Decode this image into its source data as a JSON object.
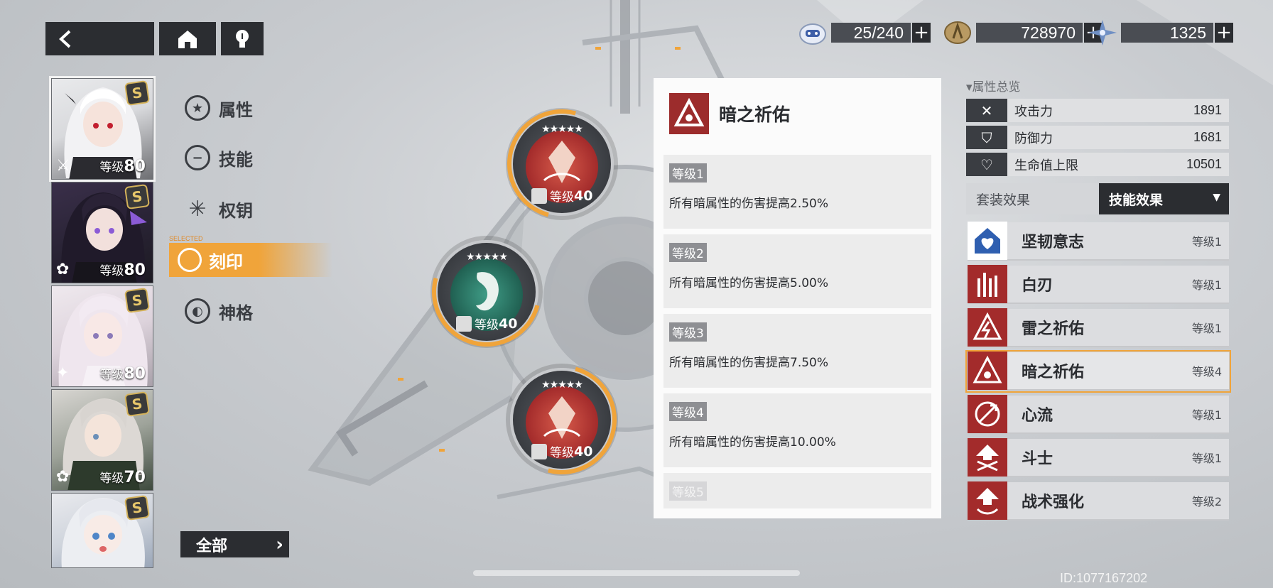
{
  "currencies": [
    {
      "name": "stamina",
      "icon": "stamina-icon",
      "value": "25/240"
    },
    {
      "name": "coin",
      "icon": "coin-icon",
      "value": "728970"
    },
    {
      "name": "crystal",
      "icon": "crystal-icon",
      "value": "1325"
    }
  ],
  "characters": [
    {
      "level_prefix": "等级",
      "level": "80",
      "badge": "S",
      "hair": "#eaeaec",
      "accent": "#c21f2f"
    },
    {
      "level_prefix": "等级",
      "level": "80",
      "badge": "S",
      "hair": "#2a2436",
      "accent": "#8b5bd6"
    },
    {
      "level_prefix": "等级",
      "level": "80",
      "badge": "S",
      "hair": "#e8dfe6",
      "accent": "#b7a6c9"
    },
    {
      "level_prefix": "等级",
      "level": "70",
      "badge": "S",
      "hair": "#d9d6d2",
      "accent": "#3a4a3a"
    },
    {
      "level_prefix": "",
      "level": "",
      "badge": "S",
      "hair": "#e6e8ee",
      "accent": "#7fa6d6"
    }
  ],
  "menu": {
    "attr": "属性",
    "skill": "技能",
    "key": "权钥",
    "selected_tag": "SELECTED",
    "imprint": "刻印",
    "divinity": "神格"
  },
  "all_button": "全部",
  "nodes": [
    {
      "stars": "★★★★★",
      "level_prefix": "等级",
      "level": "40"
    },
    {
      "stars": "★★★★★",
      "level_prefix": "等级",
      "level": "40"
    },
    {
      "stars": "★★★★★",
      "level_prefix": "等级",
      "level": "40"
    }
  ],
  "detail": {
    "title": "暗之祈佑",
    "levels": [
      {
        "tag": "等级1",
        "desc": "所有暗属性的伤害提高2.50%"
      },
      {
        "tag": "等级2",
        "desc": "所有暗属性的伤害提高5.00%"
      },
      {
        "tag": "等级3",
        "desc": "所有暗属性的伤害提高7.50%"
      },
      {
        "tag": "等级4",
        "desc": "所有暗属性的伤害提高10.00%"
      },
      {
        "tag": "等级5",
        "desc": ""
      }
    ]
  },
  "overview": {
    "title": "▾属性总览",
    "stats": [
      {
        "label": "攻击力",
        "value": "1891",
        "icon": "attack-icon"
      },
      {
        "label": "防御力",
        "value": "1681",
        "icon": "defense-icon"
      },
      {
        "label": "生命值上限",
        "value": "10501",
        "icon": "heart-icon"
      }
    ]
  },
  "tabs": {
    "set_effect": "套装效果",
    "skill_effect": "技能效果",
    "dropdown": "▼"
  },
  "effects": [
    {
      "label": "坚韧意志",
      "level": "等级1",
      "icon": "tenacity-icon",
      "color": "#2f5fb0"
    },
    {
      "label": "白刃",
      "level": "等级1",
      "icon": "blade-icon",
      "color": "#a32b2b"
    },
    {
      "label": "雷之祈佑",
      "level": "等级1",
      "icon": "thunder-icon",
      "color": "#a32b2b"
    },
    {
      "label": "暗之祈佑",
      "level": "等级4",
      "icon": "dark-icon",
      "color": "#a32b2b"
    },
    {
      "label": "心流",
      "level": "等级1",
      "icon": "flow-icon",
      "color": "#a32b2b"
    },
    {
      "label": "斗士",
      "level": "等级1",
      "icon": "fighter-icon",
      "color": "#a32b2b"
    },
    {
      "label": "战术强化",
      "level": "等级2",
      "icon": "tactics-icon",
      "color": "#a32b2b"
    }
  ],
  "uid": "ID:1077167202"
}
